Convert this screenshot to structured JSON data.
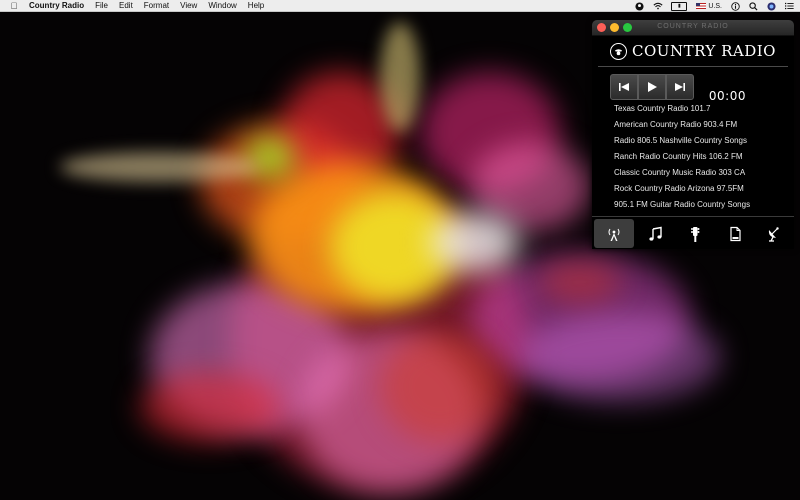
{
  "menubar": {
    "app_name": "Country Radio",
    "menus": [
      "File",
      "Edit",
      "Format",
      "View",
      "Window",
      "Help"
    ],
    "input_source": "U.S.",
    "icons": [
      "apple-icon",
      "radio-status-icon",
      "wifi-icon",
      "battery-icon",
      "flag-icon",
      "info-icon",
      "search-icon",
      "siri-icon",
      "menu-list-icon"
    ]
  },
  "window": {
    "title": "COUNTRY RADIO",
    "brand": "COUNTRY RADIO",
    "time": "00:00",
    "controls": [
      "previous",
      "play",
      "next"
    ],
    "stations": [
      "Texas Country Radio 101.7",
      "American Country Radio 903.4 FM",
      "Radio 806.5 Nashville Country Songs",
      "Ranch Radio Country Hits 106.2 FM",
      "Classic Country Music Radio 303 CA",
      "Rock Country Radio Arizona 97.5FM",
      "905.1 FM Guitar Radio Country Songs"
    ],
    "tabs": [
      {
        "name": "radio-antenna-icon",
        "active": true
      },
      {
        "name": "music-note-icon",
        "active": false
      },
      {
        "name": "guitar-headstock-icon",
        "active": false
      },
      {
        "name": "document-icon",
        "active": false
      },
      {
        "name": "satellite-dish-icon",
        "active": false
      }
    ]
  },
  "colors": {
    "window_bg": "#000000",
    "menubar_bg": "#ededed",
    "close": "#fc5f57",
    "minimize": "#fdbb2e",
    "zoom": "#28c840",
    "active_tab": "#3d3d3d"
  }
}
